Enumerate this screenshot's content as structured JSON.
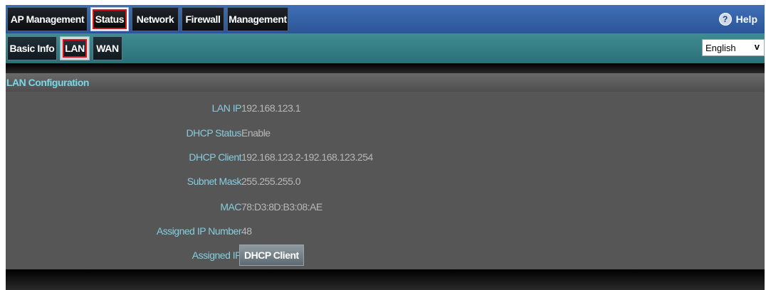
{
  "top_nav": {
    "tabs": [
      {
        "label": "AP Management"
      },
      {
        "label": "Status"
      },
      {
        "label": "Network"
      },
      {
        "label": "Firewall"
      },
      {
        "label": "Management"
      }
    ],
    "selected": "Status",
    "help_label": "Help",
    "help_glyph": "?"
  },
  "sub_nav": {
    "tabs": [
      {
        "label": "Basic Info"
      },
      {
        "label": "LAN"
      },
      {
        "label": "WAN"
      }
    ],
    "selected": "LAN",
    "language": "English"
  },
  "section": {
    "title": "LAN Configuration"
  },
  "fields": [
    {
      "label": "LAN IP",
      "value": "192.168.123.1"
    },
    {
      "label": "DHCP Status",
      "value": "Enable"
    },
    {
      "label": "DHCP Client",
      "value": "192.168.123.2-192.168.123.254"
    },
    {
      "label": "Subnet Mask",
      "value": "255.255.255.0"
    },
    {
      "label": "MAC",
      "value": "78:D3:8D:B3:08:AE"
    },
    {
      "label": "Assigned IP Number",
      "value": "48"
    },
    {
      "label": "Assigned IP",
      "value": "DHCP Client"
    }
  ],
  "colors": {
    "top_bar": "#2f5c9f",
    "sub_bar": "#2f7a82",
    "panel": "#565656",
    "label_text": "#87cde0",
    "value_text": "#b8b8b8",
    "selected_outline": "#d8121a"
  }
}
